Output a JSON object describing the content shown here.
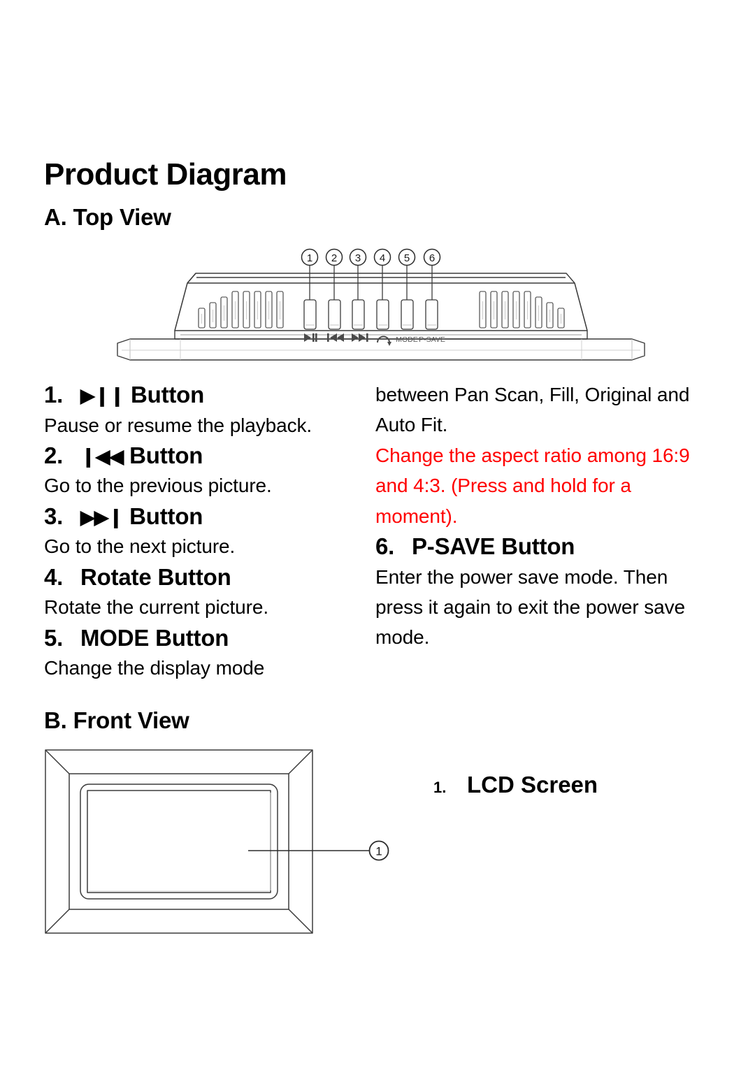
{
  "document": {
    "title": "Product Diagram"
  },
  "sections": {
    "top_view": {
      "heading": "A. Top View",
      "figure": {
        "name": "top-view-line-drawing",
        "callouts": [
          "1",
          "2",
          "3",
          "4",
          "5",
          "6"
        ],
        "button_glyphs": [
          "play-pause",
          "previous",
          "next",
          "rotate"
        ],
        "button_labels": [
          "MODE",
          "P-SAVE"
        ]
      }
    },
    "front_view": {
      "heading": "B. Front View",
      "figure": {
        "name": "front-view-line-drawing",
        "callouts": [
          "1"
        ]
      },
      "callout_label": {
        "number": "1.",
        "text": "LCD Screen"
      }
    }
  },
  "items": {
    "left": [
      {
        "number": "1.",
        "glyph": "▶❙❙",
        "glyph_name": "play-pause-icon",
        "label": "Button",
        "body": "Pause or resume the playback."
      },
      {
        "number": "2.",
        "glyph": "❙◀◀",
        "glyph_name": "previous-icon",
        "label": "Button",
        "body": "Go to the previous picture."
      },
      {
        "number": "3.",
        "glyph": "▶▶❙",
        "glyph_name": "next-icon",
        "label": "Button",
        "body": "Go to the next picture."
      },
      {
        "number": "4.",
        "glyph": "",
        "glyph_name": "",
        "label": "Rotate Button",
        "body": "Rotate the current picture."
      },
      {
        "number": "5.",
        "glyph": "",
        "glyph_name": "",
        "label": "MODE Button",
        "body": "Change the display mode"
      }
    ],
    "right": [
      {
        "number": "6.",
        "glyph": "",
        "glyph_name": "",
        "label": "P-SAVE Button",
        "body": "Enter the power save mode. Then press it again to exit the power save mode."
      }
    ]
  },
  "continuation": {
    "mode_button_text": "between Pan Scan, Fill, Original and Auto Fit.",
    "annotation_text": "Change the aspect ratio among 16:9 and 4:3. (Press and hold for a moment)."
  },
  "colors": {
    "text": "#000000",
    "annotation": "#ff0000",
    "line_art": "#3b3b3b",
    "background": "#ffffff"
  }
}
